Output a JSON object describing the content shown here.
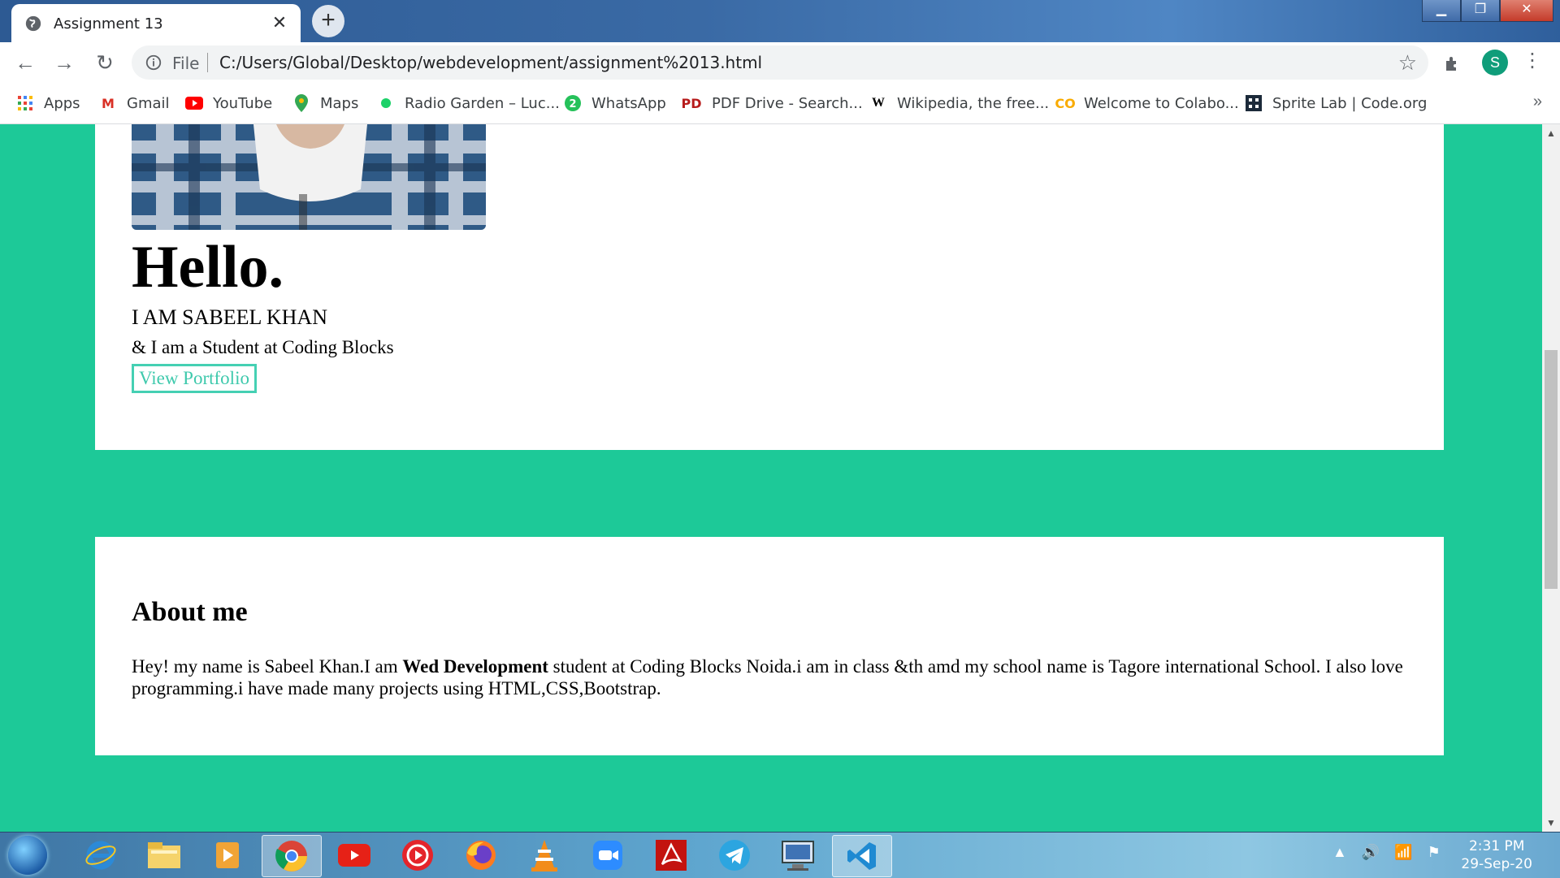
{
  "browser": {
    "tab_title": "Assignment 13",
    "tab_close": "✕",
    "new_tab": "+",
    "url_scheme_label": "File",
    "url": "C:/Users/Global/Desktop/webdevelopment/assignment%2013.html",
    "profile_initial": "S",
    "bookmarks": [
      {
        "label": "Apps",
        "icon": "apps-grid-icon"
      },
      {
        "label": "Gmail",
        "icon": "gmail-icon"
      },
      {
        "label": "YouTube",
        "icon": "youtube-icon"
      },
      {
        "label": "Maps",
        "icon": "maps-icon"
      },
      {
        "label": "Radio Garden – Luc...",
        "icon": "radio-garden-icon"
      },
      {
        "label": "WhatsApp",
        "icon": "whatsapp-icon"
      },
      {
        "label": "PDF Drive - Search...",
        "icon": "pdf-drive-icon"
      },
      {
        "label": "Wikipedia, the free...",
        "icon": "wikipedia-icon"
      },
      {
        "label": "Welcome to Colabo...",
        "icon": "colab-icon"
      },
      {
        "label": "Sprite Lab | Code.org",
        "icon": "code-org-icon"
      }
    ],
    "bookmarks_more": "»"
  },
  "page": {
    "hero": {
      "heading": "Hello.",
      "name_line": "I AM SABEEL KHAN",
      "tagline": "& I am a Student at Coding Blocks",
      "button_label": "View Portfolio"
    },
    "about": {
      "title": "About me",
      "text_before": "Hey! my name is Sabeel Khan.I am ",
      "text_bold": "Wed Development",
      "text_after": " student at Coding Blocks Noida.i am in class &th amd my school name is Tagore international School. I also love programming.i have made many projects using HTML,CSS,Bootstrap."
    }
  },
  "colors": {
    "page_background": "#1dc998",
    "card_background": "#ffffff",
    "button_accent": "#45d0b3"
  },
  "taskbar": {
    "apps": [
      "internet-explorer-icon",
      "file-explorer-icon",
      "media-player-icon",
      "chrome-icon",
      "youtube-icon",
      "music-player-icon",
      "firefox-icon",
      "vlc-icon",
      "zoom-icon",
      "acrobat-icon",
      "telegram-icon",
      "remote-desktop-icon",
      "vscode-icon"
    ],
    "time": "2:31 PM",
    "date": "29-Sep-20"
  }
}
